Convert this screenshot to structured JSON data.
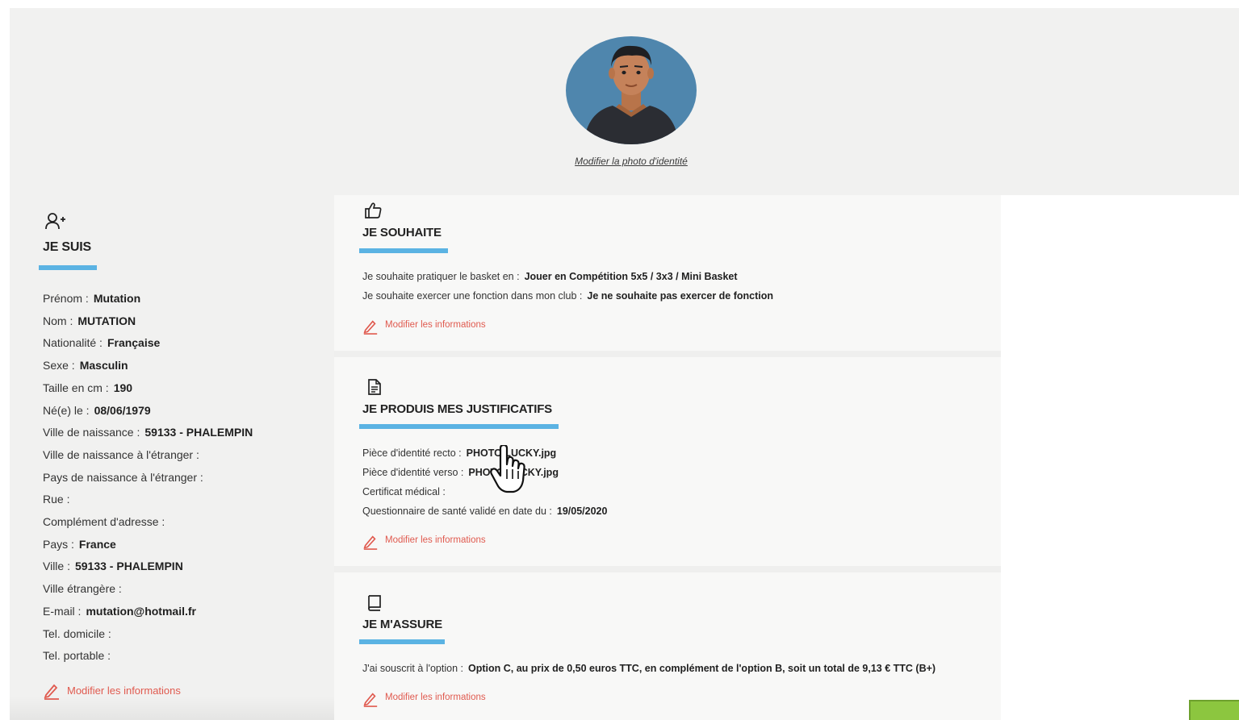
{
  "photo": {
    "change_label": "Modifier la photo d'identité"
  },
  "je_suis": {
    "title": "JE SUIS",
    "icon": "user-plus-icon",
    "fields": [
      {
        "label": "Prénom :",
        "value": "Mutation"
      },
      {
        "label": "Nom :",
        "value": "MUTATION"
      },
      {
        "label": "Nationalité :",
        "value": "Française"
      },
      {
        "label": "Sexe :",
        "value": "Masculin"
      },
      {
        "label": "Taille en cm :",
        "value": "190"
      },
      {
        "label": "Né(e) le :",
        "value": "08/06/1979"
      },
      {
        "label": "Ville de naissance :",
        "value": "59133 - PHALEMPIN"
      },
      {
        "label": "Ville de naissance à l'étranger :",
        "value": ""
      },
      {
        "label": "Pays de naissance à l'étranger :",
        "value": ""
      },
      {
        "label": "Rue :",
        "value": ""
      },
      {
        "label": "Complément d'adresse :",
        "value": ""
      },
      {
        "label": "Pays :",
        "value": "France"
      },
      {
        "label": "Ville :",
        "value": "59133 - PHALEMPIN"
      },
      {
        "label": "Ville étrangère :",
        "value": ""
      },
      {
        "label": "E-mail :",
        "value": "mutation@hotmail.fr"
      },
      {
        "label": "Tel. domicile :",
        "value": ""
      },
      {
        "label": "Tel. portable :",
        "value": ""
      }
    ],
    "edit_label": "Modifier les informations"
  },
  "je_souhaite": {
    "title": "JE SOUHAITE",
    "icon": "thumbs-up-icon",
    "rows": [
      {
        "label": "Je souhaite pratiquer le basket en :",
        "value": "Jouer en Compétition 5x5 / 3x3 / Mini Basket"
      },
      {
        "label": "Je souhaite exercer une fonction dans mon club :",
        "value": "Je ne souhaite pas exercer de fonction"
      }
    ],
    "edit_label": "Modifier les informations"
  },
  "justificatifs": {
    "title": "JE PRODUIS MES JUSTIFICATIFS",
    "icon": "document-icon",
    "rows": [
      {
        "label": "Pièce d'identité recto :",
        "value": "PHOTO LUCKY.jpg"
      },
      {
        "label": "Pièce d'identité verso :",
        "value": "PHOTO LUCKY.jpg"
      },
      {
        "label": "Certificat médical :",
        "value": ""
      },
      {
        "label": "Questionnaire de santé validé en date du :",
        "value": "19/05/2020"
      }
    ],
    "edit_label": "Modifier les informations"
  },
  "assurance": {
    "title": "JE M'ASSURE",
    "icon": "book-icon",
    "rows": [
      {
        "label": "J'ai souscrit à l'option :",
        "value": "Option C, au prix de 0,50 euros TTC, en complément de l'option B, soit un total de 9,13 € TTC (B+)"
      }
    ],
    "edit_label": "Modifier les informations"
  },
  "colors": {
    "accent_bar": "#5bb3e3",
    "edit_link": "#e05a4f",
    "green_button": "#8cc63f"
  }
}
